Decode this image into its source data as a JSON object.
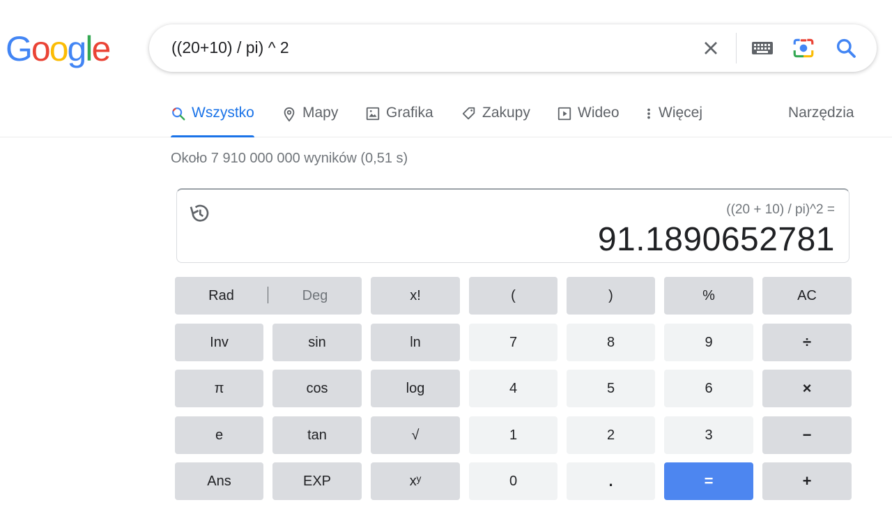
{
  "logo": {
    "letters": [
      "G",
      "o",
      "o",
      "g",
      "l",
      "e"
    ],
    "colors": [
      "#4285F4",
      "#EA4335",
      "#FBBC05",
      "#4285F4",
      "#34A853",
      "#EA4335"
    ]
  },
  "search": {
    "query": "((20+10) / pi) ^ 2",
    "icons": [
      "close-icon",
      "keyboard-icon",
      "camera-lens-icon",
      "search-icon"
    ]
  },
  "tabs": [
    {
      "label": "Wszystko",
      "icon": "search-icon",
      "active": true
    },
    {
      "label": "Mapy",
      "icon": "map-pin-icon"
    },
    {
      "label": "Grafika",
      "icon": "image-icon"
    },
    {
      "label": "Zakupy",
      "icon": "tag-icon"
    },
    {
      "label": "Wideo",
      "icon": "play-icon"
    },
    {
      "label": "Więcej",
      "icon": "more-vert-icon"
    }
  ],
  "tools_label": "Narzędzia",
  "stats": "Około 7 910 000 000 wyników (0,51 s)",
  "calculator": {
    "expression": "((20 + 10) / pi)^2 =",
    "result": "91.1890652781",
    "rad": "Rad",
    "deg": "Deg",
    "rows": [
      [
        "x!",
        "(",
        ")",
        "%",
        "AC"
      ],
      [
        "Inv",
        "sin",
        "ln",
        "7",
        "8",
        "9",
        "÷"
      ],
      [
        "π",
        "cos",
        "log",
        "4",
        "5",
        "6",
        "×"
      ],
      [
        "e",
        "tan",
        "√",
        "1",
        "2",
        "3",
        "−"
      ],
      [
        "Ans",
        "EXP",
        "xʸ",
        "0",
        ".",
        "=",
        "+"
      ]
    ]
  },
  "colors": {
    "accent": "#1a73e8",
    "equals_button": "#4d86f0"
  }
}
